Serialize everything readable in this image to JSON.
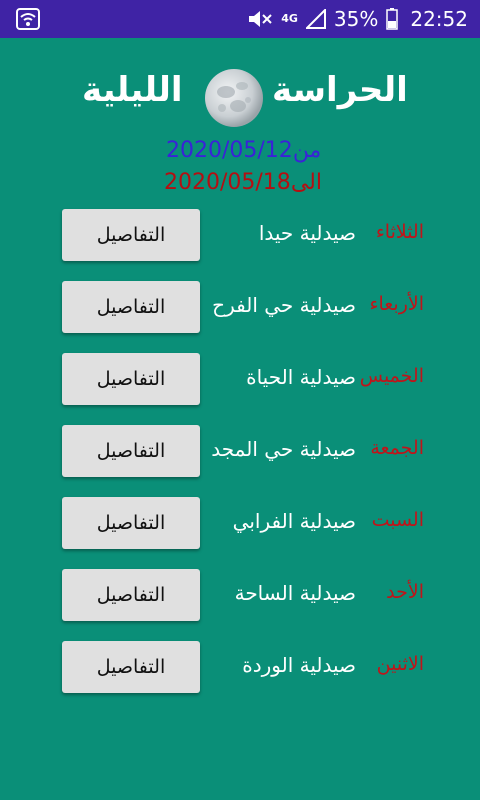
{
  "status_bar": {
    "network": "4G",
    "battery": "35%",
    "time": "22:52"
  },
  "header": {
    "title_right": "الحراسة",
    "title_left": "الليلية",
    "date_from": "من2020/05/12",
    "date_to": "الى2020/05/18"
  },
  "button_label": "التفاصيل",
  "schedule": [
    {
      "day": "الثلاثاء",
      "pharmacy": "صيدلية حيدا",
      "button": "التفاصيل"
    },
    {
      "day": "الأربعاء",
      "pharmacy": "صيدلية حي الفرح",
      "button": "التفاصيل"
    },
    {
      "day": "الخميس",
      "pharmacy": "صيدلية الحياة",
      "button": "التفاصيل"
    },
    {
      "day": "الجمعة",
      "pharmacy": "صيدلية حي المجد",
      "button": "التفاصيل"
    },
    {
      "day": "السبت",
      "pharmacy": "صيدلية الفرابي",
      "button": "التفاصيل"
    },
    {
      "day": "الأحد",
      "pharmacy": "صيدلية الساحة",
      "button": "التفاصيل"
    },
    {
      "day": "الاثنين",
      "pharmacy": "صيدلية الوردة",
      "button": "التفاصيل"
    }
  ],
  "colors": {
    "background": "#0a8f78",
    "status_bar": "#3f23a5",
    "day_text": "#c0141a",
    "date_from": "#3a22d8",
    "date_to": "#b40f12",
    "button_bg": "#e0e0e0"
  },
  "icons": [
    "wifi-icon",
    "mute-icon",
    "network-signal-icon",
    "battery-icon",
    "moon-icon"
  ]
}
